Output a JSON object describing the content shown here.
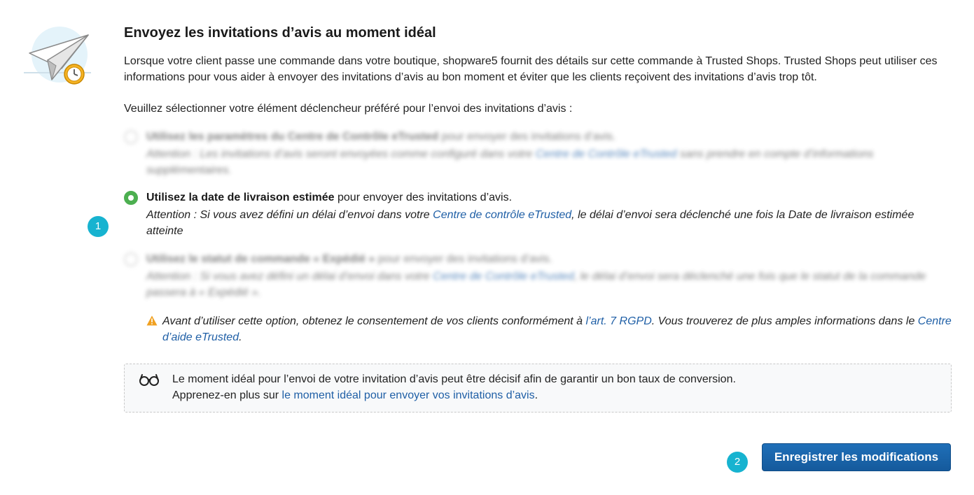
{
  "heading": {
    "title": "Envoyez les invitations d’avis au moment idéal",
    "intro": "Lorsque votre client passe une commande dans votre boutique, shopware5 fournit des détails sur cette commande à Trusted Shops. Trusted Shops peut utiliser ces informations pour vous aider à envoyer des invitations d’avis au bon moment et éviter que les clients reçoivent des invitations d’avis trop tôt.",
    "prompt": "Veuillez sélectionner votre élément déclencheur préféré pour l’envoi des invitations d’avis :"
  },
  "options": [
    {
      "label_bold": "Utilisez les paramètres du Centre de Contrôle eTrusted",
      "label_rest": " pour envoyer des invitations d’avis.",
      "note_before": "Attention : Les invitations d’avis seront envoyées comme configuré dans votre ",
      "note_link": "Centre de Contrôle eTrusted",
      "note_after": " sans prendre en compte d’informations supplémentaires.",
      "selected": false
    },
    {
      "label_bold": "Utilisez la date de livraison estimée",
      "label_rest": " pour envoyer des invitations d’avis.",
      "note_before": "Attention : Si vous avez défini un délai d’envoi dans votre ",
      "note_link": "Centre de contrôle eTrusted",
      "note_after": ", le délai d’envoi sera déclenché une fois la Date de livraison estimée atteinte",
      "selected": true
    },
    {
      "label_bold": "Utilisez le statut de commande « Expédié »",
      "label_rest": " pour envoyer des invitations d’avis.",
      "note_before": "Attention : Si vous avez défini un délai d’envoi dans votre ",
      "note_link": "Centre de Contrôle eTrusted",
      "note_after": ", le délai d’envoi sera déclenché une fois que le statut de la commande passera à « Expédié ».",
      "selected": false
    }
  ],
  "warning": {
    "before": "Avant d’utiliser cette option, obtenez le consentement de vos clients conformément à ",
    "link1": "l’art. 7 RGPD",
    "middle": ". Vous trouverez de plus amples informations dans le ",
    "link2": "Centre d’aide eTrusted",
    "after": "."
  },
  "tip": {
    "line1": "Le moment idéal pour l’envoi de votre invitation d’avis peut être décisif afin de garantir un bon taux de conversion.",
    "line2_before": "Apprenez-en plus sur ",
    "line2_link": "le moment idéal pour envoyer vos invitations d’avis",
    "line2_after": "."
  },
  "save_label": "Enregistrer les modifications",
  "steps": {
    "one": "1",
    "two": "2"
  },
  "colors": {
    "accent": "#1f6fb8",
    "link": "#1f5fa6",
    "selected_radio": "#4caf50",
    "step_badge": "#17b3d0",
    "warning": "#f0a020"
  }
}
